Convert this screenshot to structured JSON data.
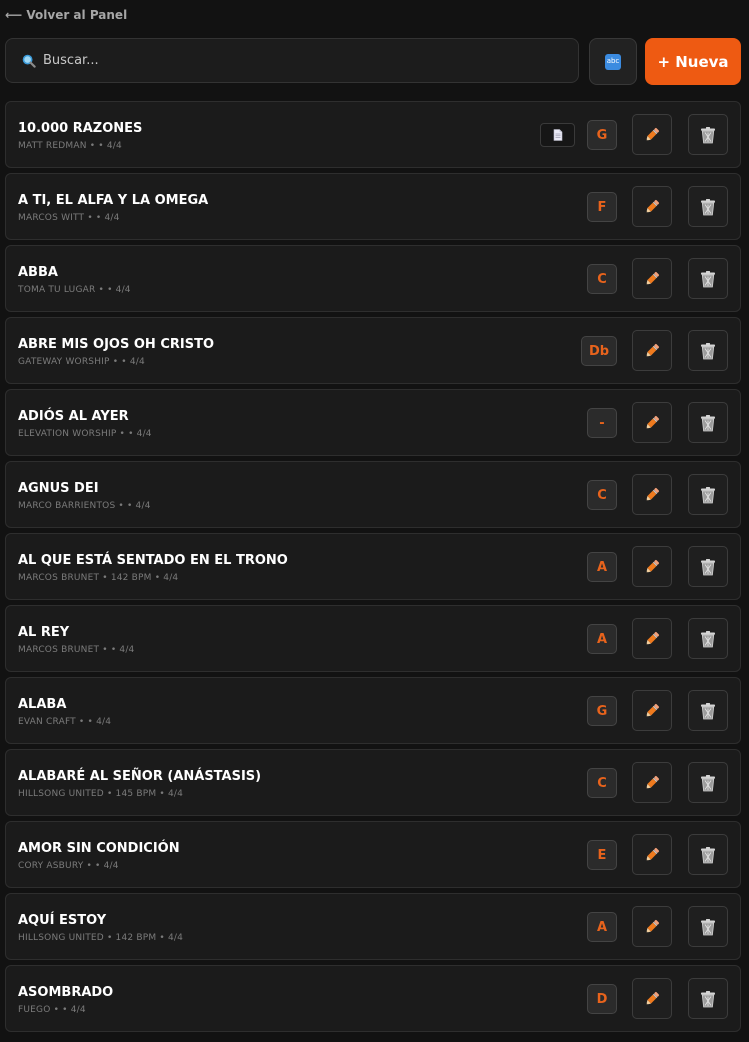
{
  "nav": {
    "back_label": "⟵ Volver al Panel"
  },
  "search": {
    "placeholder": "Buscar..."
  },
  "toolbar": {
    "sort_icon_label": "abc",
    "new_label": "+ Nueva"
  },
  "colors": {
    "accent": "#ee5a12",
    "key_text": "#e8631c",
    "background": "#121212",
    "row_bg": "#1b1b1b"
  },
  "songs": [
    {
      "title": "10.000 RAZONES",
      "meta": "MATT REDMAN • • 4/4",
      "key": "G",
      "has_doc": true
    },
    {
      "title": "A TI, EL ALFA Y LA OMEGA",
      "meta": "MARCOS WITT • • 4/4",
      "key": "F",
      "has_doc": false
    },
    {
      "title": "ABBA",
      "meta": "TOMA TU LUGAR • • 4/4",
      "key": "C",
      "has_doc": false
    },
    {
      "title": "ABRE MIS OJOS OH CRISTO",
      "meta": "GATEWAY WORSHIP • • 4/4",
      "key": "Db",
      "has_doc": false
    },
    {
      "title": "ADIÓS AL AYER",
      "meta": "ELEVATION WORSHIP • • 4/4",
      "key": "-",
      "has_doc": false
    },
    {
      "title": "AGNUS DEI",
      "meta": "MARCO BARRIENTOS • • 4/4",
      "key": "C",
      "has_doc": false
    },
    {
      "title": "AL QUE ESTÁ SENTADO EN EL TRONO",
      "meta": "MARCOS BRUNET • 142 BPM • 4/4",
      "key": "A",
      "has_doc": false
    },
    {
      "title": "AL REY",
      "meta": "MARCOS BRUNET • • 4/4",
      "key": "A",
      "has_doc": false
    },
    {
      "title": "ALABA",
      "meta": "EVAN CRAFT • • 4/4",
      "key": "G",
      "has_doc": false
    },
    {
      "title": "ALABARÉ AL SEÑOR (ANÁSTASIS)",
      "meta": "HILLSONG UNITED • 145 BPM • 4/4",
      "key": "C",
      "has_doc": false
    },
    {
      "title": "AMOR SIN CONDICIÓN",
      "meta": "CORY ASBURY • • 4/4",
      "key": "E",
      "has_doc": false
    },
    {
      "title": "AQUÍ ESTOY",
      "meta": "HILLSONG UNITED • 142 BPM • 4/4",
      "key": "A",
      "has_doc": false
    },
    {
      "title": "ASOMBRADO",
      "meta": "FUEGO • • 4/4",
      "key": "D",
      "has_doc": false
    }
  ]
}
